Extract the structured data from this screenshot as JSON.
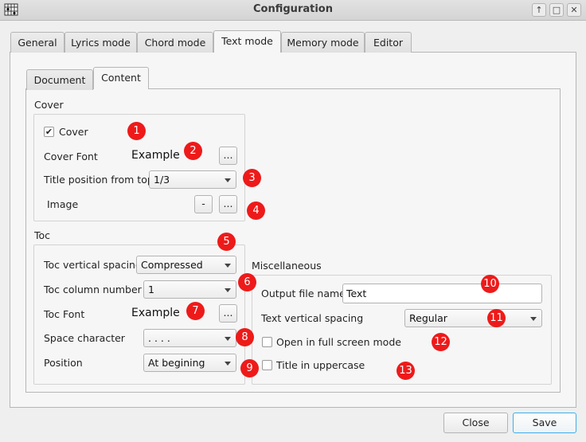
{
  "window": {
    "title": "Configuration",
    "controls": [
      "↑",
      "□",
      "✕"
    ]
  },
  "tabs": [
    {
      "label": "General"
    },
    {
      "label": "Lyrics mode"
    },
    {
      "label": "Chord mode"
    },
    {
      "label": "Text mode",
      "active": true
    },
    {
      "label": "Memory mode"
    },
    {
      "label": "Editor"
    }
  ],
  "subtabs": [
    {
      "label": "Document"
    },
    {
      "label": "Content",
      "active": true
    }
  ],
  "cover": {
    "group_label": "Cover",
    "checkbox_label": "Cover",
    "checked": true,
    "font_label": "Cover Font",
    "font_example": "Example",
    "font_button": "...",
    "title_position_label": "Title position from top",
    "title_position_value": "1/3",
    "image_label": "Image",
    "image_remove_button": "-",
    "image_browse_button": "..."
  },
  "toc": {
    "group_label": "Toc",
    "vertical_spacing_label": "Toc vertical spacing",
    "vertical_spacing_value": "Compressed",
    "column_number_label": "Toc column number",
    "column_number_value": "1",
    "font_label": "Toc Font",
    "font_example": "Example",
    "font_button": "...",
    "space_char_label": "Space character",
    "space_char_value": ". . . .",
    "position_label": "Position",
    "position_value": "At begining"
  },
  "misc": {
    "group_label": "Miscellaneous",
    "output_file_label": "Output file name",
    "output_file_value": "Text",
    "text_spacing_label": "Text vertical spacing",
    "text_spacing_value": "Regular",
    "fullscreen_label": "Open in full screen mode",
    "fullscreen_checked": false,
    "uppercase_label": "Title in uppercase",
    "uppercase_checked": false
  },
  "badges": [
    "1",
    "2",
    "3",
    "4",
    "5",
    "6",
    "7",
    "8",
    "9",
    "10",
    "11",
    "12",
    "13"
  ],
  "footer": {
    "close_label": "Close",
    "save_label": "Save"
  },
  "colors": {
    "badge": "#ee1a1a",
    "focus_accent": "#3daee9"
  }
}
